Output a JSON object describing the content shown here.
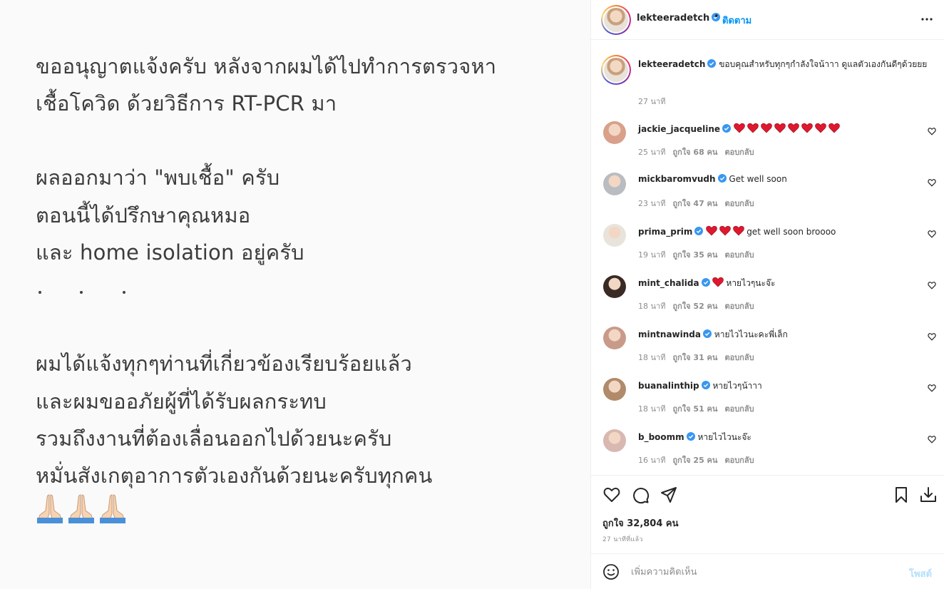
{
  "media": {
    "lines": [
      "ขออนุญาตแจ้งครับ หลังจากผมได้ไปทำการตรวจหา",
      "เชื้อโควิด ด้วยวิธีการ RT-PCR มา",
      "ผลออกมาว่า \"พบเชื้อ\" ครับ",
      "ตอนนี้ได้ปรึกษาคุณหมอ",
      "และ home isolation อยู่ครับ",
      "ผมได้แจ้งทุกๆท่านที่เกี่ยวข้องเรียบร้อยแล้ว",
      "และผมขออภัยผู้ที่ได้รับผลกระทบ",
      "รวมถึงงานที่ต้องเลื่อนออกไปด้วยนะครับ",
      "หมั่นสังเกตุอาการตัวเองกันด้วยนะครับทุกคน"
    ],
    "emoji": "🙏🙏🙏"
  },
  "header": {
    "username": "lekteeradetch",
    "separator": "•",
    "follow_label": "ติดตาม"
  },
  "caption": {
    "username": "lekteeradetch",
    "text": "ขอบคุณสำหรับทุกๆกำลังใจน้าาา ดูแลตัวเองกันดีๆด้วยยย",
    "time": "27 นาที"
  },
  "comments": [
    {
      "username": "jackie_jacqueline",
      "text": "",
      "hearts": 8,
      "time": "25 นาที",
      "likes": "ถูกใจ 68 คน",
      "reply": "ตอบกลับ",
      "avatar_color": "#d9a08a"
    },
    {
      "username": "mickbaromvudh",
      "text": "Get well soon",
      "hearts": 0,
      "time": "23 นาที",
      "likes": "ถูกใจ 47 คน",
      "reply": "ตอบกลับ",
      "avatar_color": "#b9bcc0"
    },
    {
      "username": "prima_prim",
      "text": "get well soon broooo",
      "hearts": 3,
      "time": "19 นาที",
      "likes": "ถูกใจ 35 คน",
      "reply": "ตอบกลับ",
      "avatar_color": "#e8e4dc"
    },
    {
      "username": "mint_chalida",
      "text": "หายไวๆนะจ๊ะ",
      "hearts": 1,
      "time": "18 นาที",
      "likes": "ถูกใจ 52 คน",
      "reply": "ตอบกลับ",
      "avatar_color": "#3a2a24"
    },
    {
      "username": "mintnawinda",
      "text": "หายไวไวนะคะพี่เล็ก",
      "hearts": 0,
      "time": "18 นาที",
      "likes": "ถูกใจ 31 คน",
      "reply": "ตอบกลับ",
      "avatar_color": "#c99a8a"
    },
    {
      "username": "buanalinthip",
      "text": "หายไวๆน้าาา",
      "hearts": 0,
      "time": "18 นาที",
      "likes": "ถูกใจ 51 คน",
      "reply": "ตอบกลับ",
      "avatar_color": "#b08a6a"
    },
    {
      "username": "b_boomm",
      "text": "หายไวไวนะจ๊ะ",
      "hearts": 0,
      "time": "16 นาที",
      "likes": "ถูกใจ 25 คน",
      "reply": "ตอบกลับ",
      "avatar_color": "#d8b8b0"
    }
  ],
  "actions": {
    "likes_text": "ถูกใจ 32,804 คน",
    "posted_time": "27 นาทีที่แล้ว"
  },
  "add_comment": {
    "placeholder": "เพิ่มความคิดเห็น",
    "post_label": "โพสต์"
  },
  "colors": {
    "link_blue": "#0095f6",
    "verified_blue": "#3897f0",
    "heart_red": "#e0182e",
    "post_disabled": "#b2dffc"
  },
  "icons": [
    "verified-badge-icon",
    "more-options-icon",
    "heart-outline-icon",
    "comment-icon",
    "share-icon",
    "bookmark-icon",
    "download-icon",
    "emoji-icon",
    "red-heart-emoji-icon",
    "praying-hands-emoji-icon"
  ]
}
